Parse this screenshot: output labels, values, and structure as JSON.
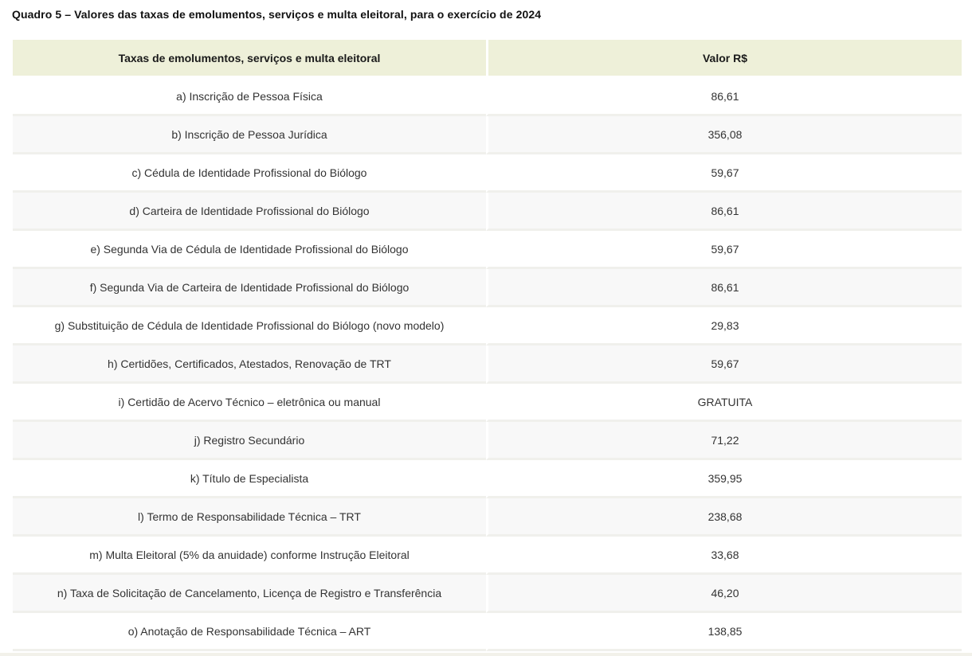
{
  "title": "Quadro 5 – Valores das taxas de emolumentos, serviços e multa eleitoral, para o exercício de 2024",
  "table": {
    "headers": [
      "Taxas de emolumentos, serviços e multa eleitoral",
      "Valor R$"
    ],
    "rows": [
      {
        "item": "a) Inscrição de Pessoa Física",
        "value": "86,61"
      },
      {
        "item": "b) Inscrição de Pessoa Jurídica",
        "value": "356,08"
      },
      {
        "item": "c) Cédula de Identidade Profissional do Biólogo",
        "value": "59,67"
      },
      {
        "item": "d) Carteira de Identidade Profissional do Biólogo",
        "value": "86,61"
      },
      {
        "item": "e) Segunda Via de Cédula de Identidade Profissional do Biólogo",
        "value": "59,67"
      },
      {
        "item": "f) Segunda Via de Carteira de Identidade Profissional do Biólogo",
        "value": "86,61"
      },
      {
        "item": "g) Substituição de Cédula de Identidade Profissional do Biólogo (novo modelo)",
        "value": "29,83"
      },
      {
        "item": "h) Certidões, Certificados, Atestados, Renovação de TRT",
        "value": "59,67"
      },
      {
        "item": "i) Certidão de Acervo Técnico – eletrônica ou manual",
        "value": "GRATUITA"
      },
      {
        "item": "j) Registro Secundário",
        "value": "71,22"
      },
      {
        "item": "k) Título de Especialista",
        "value": "359,95"
      },
      {
        "item": "l) Termo de Responsabilidade Técnica – TRT",
        "value": "238,68"
      },
      {
        "item": "m) Multa Eleitoral (5% da anuidade) conforme Instrução Eleitoral",
        "value": "33,68"
      },
      {
        "item": "n) Taxa de Solicitação de Cancelamento, Licença de Registro e Transferência",
        "value": "46,20"
      },
      {
        "item": "o) Anotação de Responsabilidade Técnica – ART",
        "value": "138,85"
      }
    ]
  },
  "colors": {
    "header_background": "#eef0d9",
    "row_alt_background": "#f8f8f8"
  }
}
